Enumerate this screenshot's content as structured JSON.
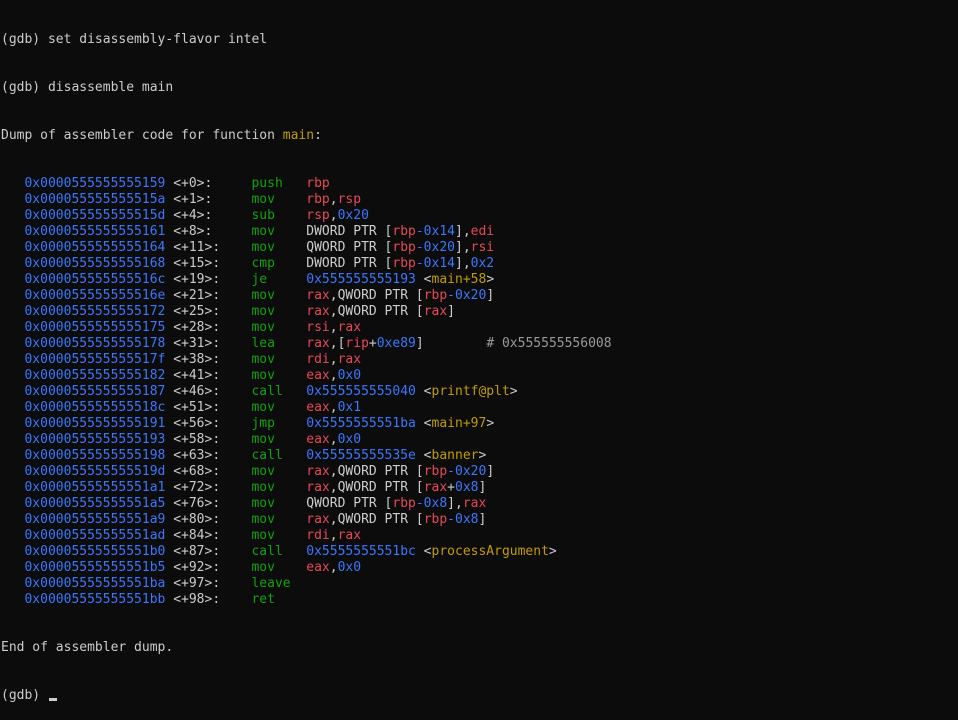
{
  "session": {
    "cmd1": "(gdb) set disassembly-flavor intel",
    "cmd2": "(gdb) disassemble main",
    "dump_header_prefix": "Dump of assembler code for function ",
    "dump_header_fn": "main",
    "dump_header_suffix": ":",
    "footer": "End of assembler dump.",
    "prompt": "(gdb) "
  },
  "lines": [
    {
      "addr": "0x0000555555555159",
      "off": "<+0>:",
      "mn": "push",
      "ops": [
        [
          "reg",
          "rbp"
        ]
      ]
    },
    {
      "addr": "0x000055555555515a",
      "off": "<+1>:",
      "mn": "mov",
      "ops": [
        [
          "reg",
          "rbp"
        ],
        [
          "plain",
          ","
        ],
        [
          "reg",
          "rsp"
        ]
      ]
    },
    {
      "addr": "0x000055555555515d",
      "off": "<+4>:",
      "mn": "sub",
      "ops": [
        [
          "reg",
          "rsp"
        ],
        [
          "plain",
          ","
        ],
        [
          "num",
          "0x20"
        ]
      ]
    },
    {
      "addr": "0x0000555555555161",
      "off": "<+8>:",
      "mn": "mov",
      "ops": [
        [
          "plain",
          "DWORD PTR ["
        ],
        [
          "reg",
          "rbp"
        ],
        [
          "num",
          "-0x14"
        ],
        [
          "plain",
          "],"
        ],
        [
          "reg",
          "edi"
        ]
      ]
    },
    {
      "addr": "0x0000555555555164",
      "off": "<+11>:",
      "mn": "mov",
      "ops": [
        [
          "plain",
          "QWORD PTR ["
        ],
        [
          "reg",
          "rbp"
        ],
        [
          "num",
          "-0x20"
        ],
        [
          "plain",
          "],"
        ],
        [
          "reg",
          "rsi"
        ]
      ]
    },
    {
      "addr": "0x0000555555555168",
      "off": "<+15>:",
      "mn": "cmp",
      "ops": [
        [
          "plain",
          "DWORD PTR ["
        ],
        [
          "reg",
          "rbp"
        ],
        [
          "num",
          "-0x14"
        ],
        [
          "plain",
          "],"
        ],
        [
          "num",
          "0x2"
        ]
      ]
    },
    {
      "addr": "0x000055555555516c",
      "off": "<+19>:",
      "mn": "je",
      "ops": [
        [
          "num",
          "0x555555555193"
        ],
        [
          "plain",
          " <"
        ],
        [
          "sym",
          "main+58"
        ],
        [
          "plain",
          ">"
        ]
      ]
    },
    {
      "addr": "0x000055555555516e",
      "off": "<+21>:",
      "mn": "mov",
      "ops": [
        [
          "reg",
          "rax"
        ],
        [
          "plain",
          ",QWORD PTR ["
        ],
        [
          "reg",
          "rbp"
        ],
        [
          "num",
          "-0x20"
        ],
        [
          "plain",
          "]"
        ]
      ]
    },
    {
      "addr": "0x0000555555555172",
      "off": "<+25>:",
      "mn": "mov",
      "ops": [
        [
          "reg",
          "rax"
        ],
        [
          "plain",
          ",QWORD PTR ["
        ],
        [
          "reg",
          "rax"
        ],
        [
          "plain",
          "]"
        ]
      ]
    },
    {
      "addr": "0x0000555555555175",
      "off": "<+28>:",
      "mn": "mov",
      "ops": [
        [
          "reg",
          "rsi"
        ],
        [
          "plain",
          ","
        ],
        [
          "reg",
          "rax"
        ]
      ]
    },
    {
      "addr": "0x0000555555555178",
      "off": "<+31>:",
      "mn": "lea",
      "ops": [
        [
          "reg",
          "rax"
        ],
        [
          "plain",
          ",["
        ],
        [
          "reg",
          "rip"
        ],
        [
          "plain",
          "+"
        ],
        [
          "num",
          "0xe89"
        ],
        [
          "plain",
          "]        "
        ],
        [
          "cmt",
          "# 0x555555556008"
        ]
      ]
    },
    {
      "addr": "0x000055555555517f",
      "off": "<+38>:",
      "mn": "mov",
      "ops": [
        [
          "reg",
          "rdi"
        ],
        [
          "plain",
          ","
        ],
        [
          "reg",
          "rax"
        ]
      ]
    },
    {
      "addr": "0x0000555555555182",
      "off": "<+41>:",
      "mn": "mov",
      "ops": [
        [
          "reg",
          "eax"
        ],
        [
          "plain",
          ","
        ],
        [
          "num",
          "0x0"
        ]
      ]
    },
    {
      "addr": "0x0000555555555187",
      "off": "<+46>:",
      "mn": "call",
      "ops": [
        [
          "num",
          "0x555555555040"
        ],
        [
          "plain",
          " <"
        ],
        [
          "sym",
          "printf@plt"
        ],
        [
          "plain",
          ">"
        ]
      ]
    },
    {
      "addr": "0x000055555555518c",
      "off": "<+51>:",
      "mn": "mov",
      "ops": [
        [
          "reg",
          "eax"
        ],
        [
          "plain",
          ","
        ],
        [
          "num",
          "0x1"
        ]
      ]
    },
    {
      "addr": "0x0000555555555191",
      "off": "<+56>:",
      "mn": "jmp",
      "ops": [
        [
          "num",
          "0x5555555551ba"
        ],
        [
          "plain",
          " <"
        ],
        [
          "sym",
          "main+97"
        ],
        [
          "plain",
          ">"
        ]
      ]
    },
    {
      "addr": "0x0000555555555193",
      "off": "<+58>:",
      "mn": "mov",
      "ops": [
        [
          "reg",
          "eax"
        ],
        [
          "plain",
          ","
        ],
        [
          "num",
          "0x0"
        ]
      ]
    },
    {
      "addr": "0x0000555555555198",
      "off": "<+63>:",
      "mn": "call",
      "ops": [
        [
          "num",
          "0x55555555535e"
        ],
        [
          "plain",
          " <"
        ],
        [
          "sym",
          "banner"
        ],
        [
          "plain",
          ">"
        ]
      ]
    },
    {
      "addr": "0x000055555555519d",
      "off": "<+68>:",
      "mn": "mov",
      "ops": [
        [
          "reg",
          "rax"
        ],
        [
          "plain",
          ",QWORD PTR ["
        ],
        [
          "reg",
          "rbp"
        ],
        [
          "num",
          "-0x20"
        ],
        [
          "plain",
          "]"
        ]
      ]
    },
    {
      "addr": "0x00005555555551a1",
      "off": "<+72>:",
      "mn": "mov",
      "ops": [
        [
          "reg",
          "rax"
        ],
        [
          "plain",
          ",QWORD PTR ["
        ],
        [
          "reg",
          "rax"
        ],
        [
          "plain",
          "+"
        ],
        [
          "num",
          "0x8"
        ],
        [
          "plain",
          "]"
        ]
      ]
    },
    {
      "addr": "0x00005555555551a5",
      "off": "<+76>:",
      "mn": "mov",
      "ops": [
        [
          "plain",
          "QWORD PTR ["
        ],
        [
          "reg",
          "rbp"
        ],
        [
          "num",
          "-0x8"
        ],
        [
          "plain",
          "],"
        ],
        [
          "reg",
          "rax"
        ]
      ]
    },
    {
      "addr": "0x00005555555551a9",
      "off": "<+80>:",
      "mn": "mov",
      "ops": [
        [
          "reg",
          "rax"
        ],
        [
          "plain",
          ",QWORD PTR ["
        ],
        [
          "reg",
          "rbp"
        ],
        [
          "num",
          "-0x8"
        ],
        [
          "plain",
          "]"
        ]
      ]
    },
    {
      "addr": "0x00005555555551ad",
      "off": "<+84>:",
      "mn": "mov",
      "ops": [
        [
          "reg",
          "rdi"
        ],
        [
          "plain",
          ","
        ],
        [
          "reg",
          "rax"
        ]
      ]
    },
    {
      "addr": "0x00005555555551b0",
      "off": "<+87>:",
      "mn": "call",
      "ops": [
        [
          "num",
          "0x5555555551bc"
        ],
        [
          "plain",
          " <"
        ],
        [
          "sym",
          "processArgument"
        ],
        [
          "plain",
          ">"
        ]
      ]
    },
    {
      "addr": "0x00005555555551b5",
      "off": "<+92>:",
      "mn": "mov",
      "ops": [
        [
          "reg",
          "eax"
        ],
        [
          "plain",
          ","
        ],
        [
          "num",
          "0x0"
        ]
      ]
    },
    {
      "addr": "0x00005555555551ba",
      "off": "<+97>:",
      "mn": "leave",
      "ops": []
    },
    {
      "addr": "0x00005555555551bb",
      "off": "<+98>:",
      "mn": "ret",
      "ops": []
    }
  ],
  "colors": {
    "background": "#0c0c0c",
    "text": "#cccccc",
    "address": "#3b78ff",
    "mnemonic": "#13a10e",
    "register": "#e74856",
    "symbol": "#c19c00",
    "comment": "#9a9a9a"
  }
}
